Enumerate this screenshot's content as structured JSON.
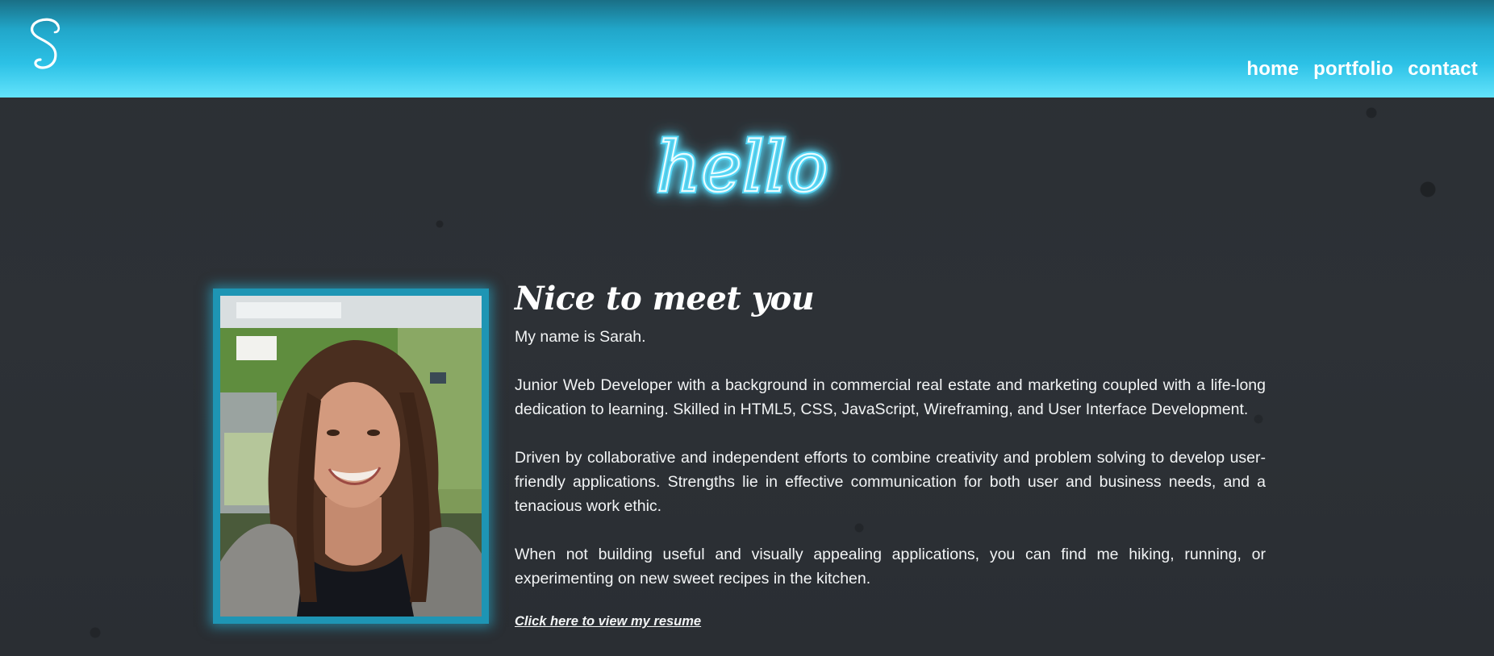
{
  "header": {
    "logo_icon": "script-s-logo-icon",
    "nav": [
      {
        "label": "home"
      },
      {
        "label": "portfolio"
      },
      {
        "label": "contact"
      }
    ],
    "gradient_colors": [
      "#1a6f86",
      "#2cc1e6",
      "#63e3fb"
    ]
  },
  "hero": {
    "heading_word": "hello",
    "glow_color": "#56d6f5"
  },
  "profile": {
    "photo_alt": "profile-photo",
    "frame_color": "#1e95b4"
  },
  "about": {
    "title": "Nice to meet you",
    "intro": "My name is Sarah.",
    "paragraphs": [
      "Junior Web Developer with a background in commercial real estate and marketing coupled with a life-long dedication to learning. Skilled in HTML5, CSS, JavaScript, Wireframing, and User Interface Development.",
      "Driven by collaborative and independent efforts to combine creativity and problem solving to develop user-friendly applications. Strengths lie in effective communication for both user and business needs, and a tenacious work ethic.",
      "When not building useful and visually appealing applications, you can find me hiking, running, or experimenting on new sweet recipes in the kitchen."
    ],
    "resume_link": "Click here to view my resume"
  },
  "colors": {
    "background": "#2b2f34",
    "text": "#f2f4f5",
    "accent": "#2cc1e6"
  }
}
